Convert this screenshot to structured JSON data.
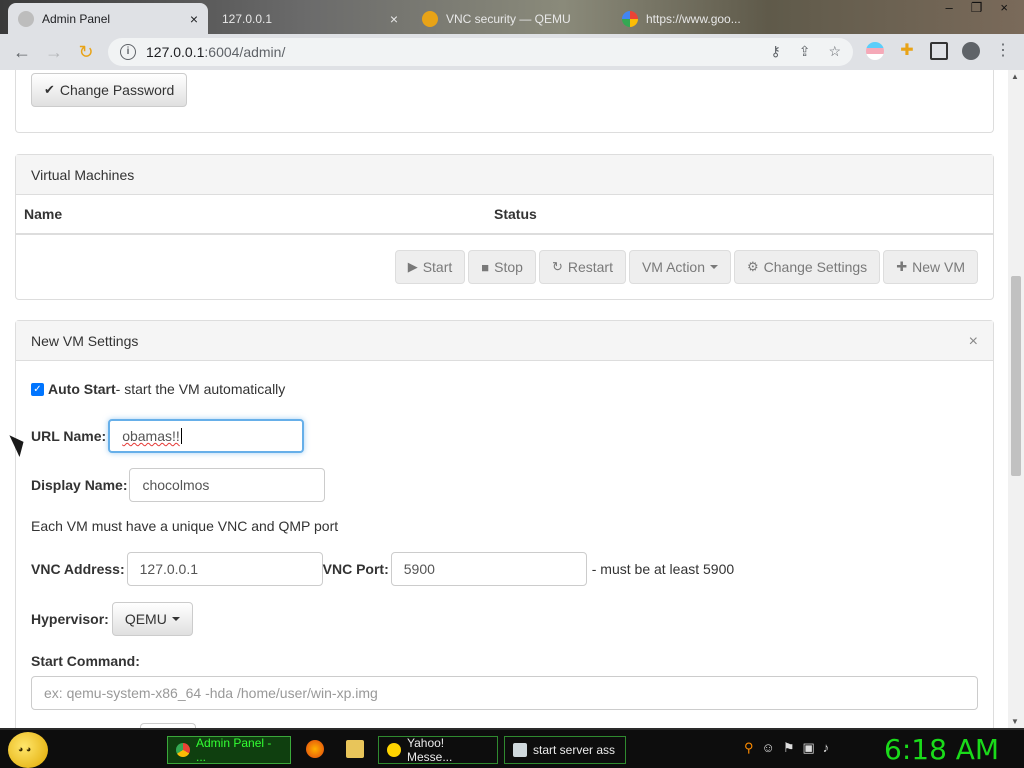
{
  "browser": {
    "tabs": [
      {
        "title": "Admin Panel",
        "active": true
      },
      {
        "title": "127.0.0.1",
        "active": false
      },
      {
        "title": "VNC security — QEMU",
        "active": false
      },
      {
        "title": "https://www.goo...",
        "active": false
      }
    ],
    "close_glyph": "×",
    "url_host": "127.0.0.1",
    "url_path": ":6004/admin/"
  },
  "password_panel": {
    "change_password_label": "Change Password"
  },
  "vm_panel": {
    "title": "Virtual Machines",
    "columns": [
      "Name",
      "Status"
    ],
    "actions": {
      "start": "Start",
      "stop": "Stop",
      "restart": "Restart",
      "vm_action": "VM Action",
      "change_settings": "Change Settings",
      "new_vm": "New VM"
    }
  },
  "settings_panel": {
    "title": "New VM Settings",
    "close": "×",
    "auto_start_label": "Auto Start",
    "auto_start_desc": "- start the VM automatically",
    "url_name_label": "URL Name:",
    "url_name_value": "obamas!!",
    "display_name_label": "Display Name:",
    "display_name_value": "chocolmos",
    "unique_note": "Each VM must have a unique VNC and QMP port",
    "vnc_address_label": "VNC Address:",
    "vnc_address_value": "127.0.0.1",
    "vnc_port_label": "VNC Port:",
    "vnc_port_value": "5900",
    "vnc_port_note": "- must be at least 5900",
    "hypervisor_label": "Hypervisor:",
    "hypervisor_value": "QEMU",
    "start_command_label": "Start Command:",
    "start_command_placeholder": "ex: qemu-system-x86_64 -hda /home/user/win-xp.img"
  },
  "taskbar": {
    "items": [
      {
        "label": "Admin Panel - ...",
        "active": true
      },
      {
        "label": "Yahoo! Messe...",
        "active": false
      },
      {
        "label": "start server ass",
        "active": false
      }
    ],
    "clock": "6:18 AM"
  }
}
